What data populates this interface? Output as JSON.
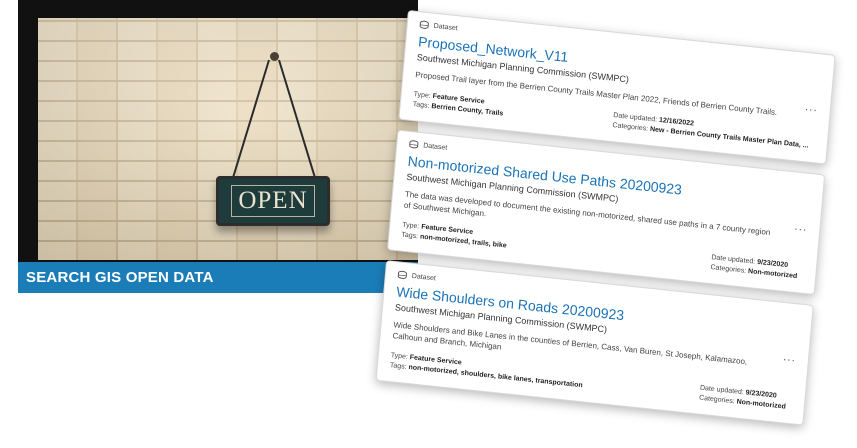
{
  "banner": {
    "sign_text": "OPEN",
    "title": "SEARCH GIS OPEN DATA",
    "bar_color": "#1b7db8"
  },
  "results": [
    {
      "type_label": "Dataset",
      "icon": "database-icon",
      "title": "Proposed_Network_V11",
      "publisher": "Southwest Michigan Planning Commission (SWMPC)",
      "description": "Proposed Trail layer from the Berrien County Trails Master Plan 2022, Friends of Berrien County Trails.",
      "type_key": "Type:",
      "type_value": "Feature Service",
      "tags_key": "Tags:",
      "tags_value": "Berrien County, Trails",
      "date_key": "Date updated:",
      "date_value": "12/16/2022",
      "categories_key": "Categories:",
      "categories_value": "New - Berrien County Trails Master Plan Data, ...",
      "more": "..."
    },
    {
      "type_label": "Dataset",
      "icon": "database-icon",
      "title": "Non-motorized Shared Use Paths 20200923",
      "publisher": "Southwest Michigan Planning Commission (SWMPC)",
      "description": "The data was developed to document the existing non-motorized, shared use paths in a 7 county region of Southwest Michigan.",
      "type_key": "Type:",
      "type_value": "Feature Service",
      "tags_key": "Tags:",
      "tags_value": "non-motorized, trails, bike",
      "date_key": "Date updated:",
      "date_value": "9/23/2020",
      "categories_key": "Categories:",
      "categories_value": "Non-motorized",
      "more": "..."
    },
    {
      "type_label": "Dataset",
      "icon": "database-icon",
      "title": "Wide Shoulders on Roads 20200923",
      "publisher": "Southwest Michigan Planning Commission (SWMPC)",
      "description": "Wide Shoulders and Bike Lanes in the counties of Berrien, Cass, Van Buren, St Joseph, Kalamazoo, Calhoun and Branch, Michigan",
      "type_key": "Type:",
      "type_value": "Feature Service",
      "tags_key": "Tags:",
      "tags_value": "non-motorized, shoulders, bike lanes, transportation",
      "date_key": "Date updated:",
      "date_value": "9/23/2020",
      "categories_key": "Categories:",
      "categories_value": "Non-motorized",
      "more": "..."
    }
  ]
}
